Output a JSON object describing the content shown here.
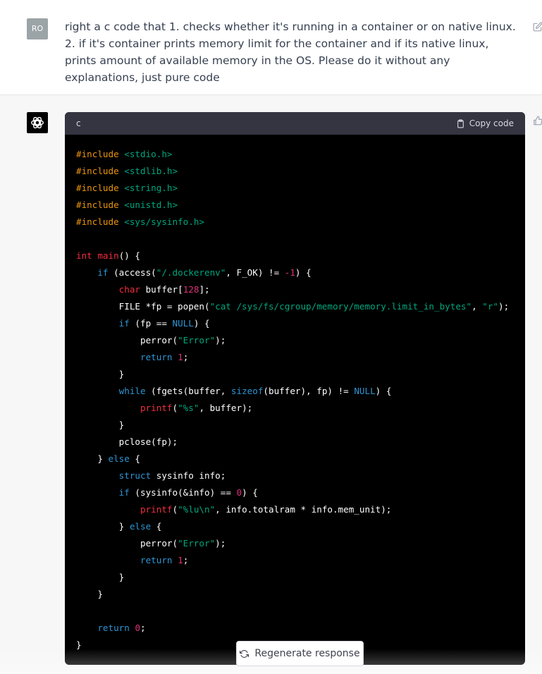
{
  "user_message": {
    "avatar_initials": "RO",
    "text": "right a c code that 1. checks whether it's running in a container or on native linux. 2. if it's container prints memory limit for the container and if its native linux, prints amount of available memory in the OS. Please do it without any explanations, just pure code"
  },
  "code_block": {
    "language": "c",
    "copy_label": "Copy code",
    "lines": [
      [
        {
          "c": "p",
          "t": "#include "
        },
        {
          "c": "s",
          "t": "<stdio.h>"
        }
      ],
      [
        {
          "c": "p",
          "t": "#include "
        },
        {
          "c": "s",
          "t": "<stdlib.h>"
        }
      ],
      [
        {
          "c": "p",
          "t": "#include "
        },
        {
          "c": "s",
          "t": "<string.h>"
        }
      ],
      [
        {
          "c": "p",
          "t": "#include "
        },
        {
          "c": "s",
          "t": "<unistd.h>"
        }
      ],
      [
        {
          "c": "p",
          "t": "#include "
        },
        {
          "c": "s",
          "t": "<sys/sysinfo.h>"
        }
      ],
      [],
      [
        {
          "c": "t",
          "t": "int"
        },
        {
          "c": "m",
          "t": " "
        },
        {
          "c": "f",
          "t": "main"
        },
        {
          "c": "m",
          "t": "() {"
        }
      ],
      [
        {
          "c": "m",
          "t": "    "
        },
        {
          "c": "k",
          "t": "if"
        },
        {
          "c": "m",
          "t": " (access("
        },
        {
          "c": "s",
          "t": "\"/.dockerenv\""
        },
        {
          "c": "m",
          "t": ", F_OK) != "
        },
        {
          "c": "n",
          "t": "-1"
        },
        {
          "c": "m",
          "t": ") {"
        }
      ],
      [
        {
          "c": "m",
          "t": "        "
        },
        {
          "c": "t",
          "t": "char"
        },
        {
          "c": "m",
          "t": " buffer["
        },
        {
          "c": "n",
          "t": "128"
        },
        {
          "c": "m",
          "t": "];"
        }
      ],
      [
        {
          "c": "m",
          "t": "        FILE *fp = popen("
        },
        {
          "c": "s",
          "t": "\"cat /sys/fs/cgroup/memory/memory.limit_in_bytes\""
        },
        {
          "c": "m",
          "t": ", "
        },
        {
          "c": "s",
          "t": "\"r\""
        },
        {
          "c": "m",
          "t": ");"
        }
      ],
      [
        {
          "c": "m",
          "t": "        "
        },
        {
          "c": "k",
          "t": "if"
        },
        {
          "c": "m",
          "t": " (fp == "
        },
        {
          "c": "k",
          "t": "NULL"
        },
        {
          "c": "m",
          "t": ") {"
        }
      ],
      [
        {
          "c": "m",
          "t": "            perror("
        },
        {
          "c": "s",
          "t": "\"Error\""
        },
        {
          "c": "m",
          "t": ");"
        }
      ],
      [
        {
          "c": "m",
          "t": "            "
        },
        {
          "c": "k",
          "t": "return"
        },
        {
          "c": "m",
          "t": " "
        },
        {
          "c": "n",
          "t": "1"
        },
        {
          "c": "m",
          "t": ";"
        }
      ],
      [
        {
          "c": "m",
          "t": "        }"
        }
      ],
      [
        {
          "c": "m",
          "t": "        "
        },
        {
          "c": "k",
          "t": "while"
        },
        {
          "c": "m",
          "t": " (fgets(buffer, "
        },
        {
          "c": "k",
          "t": "sizeof"
        },
        {
          "c": "m",
          "t": "(buffer), fp) != "
        },
        {
          "c": "k",
          "t": "NULL"
        },
        {
          "c": "m",
          "t": ") {"
        }
      ],
      [
        {
          "c": "m",
          "t": "            "
        },
        {
          "c": "f",
          "t": "printf"
        },
        {
          "c": "m",
          "t": "("
        },
        {
          "c": "s",
          "t": "\"%s\""
        },
        {
          "c": "m",
          "t": ", buffer);"
        }
      ],
      [
        {
          "c": "m",
          "t": "        }"
        }
      ],
      [
        {
          "c": "m",
          "t": "        pclose(fp);"
        }
      ],
      [
        {
          "c": "m",
          "t": "    } "
        },
        {
          "c": "k",
          "t": "else"
        },
        {
          "c": "m",
          "t": " {"
        }
      ],
      [
        {
          "c": "m",
          "t": "        "
        },
        {
          "c": "k",
          "t": "struct"
        },
        {
          "c": "m",
          "t": " sysinfo info;"
        }
      ],
      [
        {
          "c": "m",
          "t": "        "
        },
        {
          "c": "k",
          "t": "if"
        },
        {
          "c": "m",
          "t": " (sysinfo(&info) == "
        },
        {
          "c": "n",
          "t": "0"
        },
        {
          "c": "m",
          "t": ") {"
        }
      ],
      [
        {
          "c": "m",
          "t": "            "
        },
        {
          "c": "f",
          "t": "printf"
        },
        {
          "c": "m",
          "t": "("
        },
        {
          "c": "s",
          "t": "\"%lu\\n\""
        },
        {
          "c": "m",
          "t": ", info.totalram * info.mem_unit);"
        }
      ],
      [
        {
          "c": "m",
          "t": "        } "
        },
        {
          "c": "k",
          "t": "else"
        },
        {
          "c": "m",
          "t": " {"
        }
      ],
      [
        {
          "c": "m",
          "t": "            perror("
        },
        {
          "c": "s",
          "t": "\"Error\""
        },
        {
          "c": "m",
          "t": ");"
        }
      ],
      [
        {
          "c": "m",
          "t": "            "
        },
        {
          "c": "k",
          "t": "return"
        },
        {
          "c": "m",
          "t": " "
        },
        {
          "c": "n",
          "t": "1"
        },
        {
          "c": "m",
          "t": ";"
        }
      ],
      [
        {
          "c": "m",
          "t": "        }"
        }
      ],
      [
        {
          "c": "m",
          "t": "    }"
        }
      ],
      [],
      [
        {
          "c": "m",
          "t": "    "
        },
        {
          "c": "k",
          "t": "return"
        },
        {
          "c": "m",
          "t": " "
        },
        {
          "c": "n",
          "t": "0"
        },
        {
          "c": "m",
          "t": ";"
        }
      ],
      [
        {
          "c": "m",
          "t": "}"
        }
      ]
    ]
  },
  "regenerate_label": "Regenerate response",
  "colors": {
    "keyword": "#2e95d3",
    "type": "#f22c3d",
    "string": "#00a67d",
    "number": "#df3079",
    "preprocessor": "#e9950c",
    "code_bg": "#000000",
    "code_header_bg": "#343541"
  },
  "icons": [
    "edit-icon",
    "openai-logo-icon",
    "thumbs-up-icon",
    "clipboard-icon",
    "refresh-icon"
  ]
}
